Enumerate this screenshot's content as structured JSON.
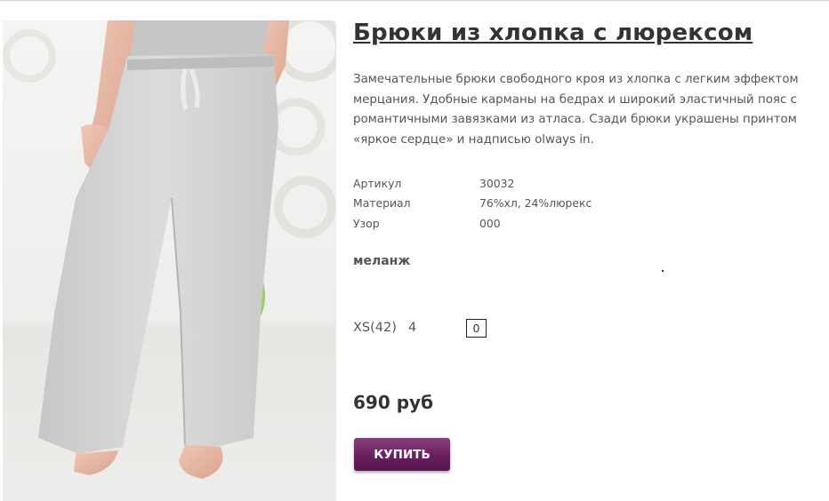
{
  "product": {
    "title": "Брюки из хлопка с люрексом",
    "description": "Замечательные брюки свободного кроя из хлопка с легким эффектом мерцания. Удобные карманы на бедрах и широкий эластичный пояс с романтичными завязками из атласа. Сзади брюки украшены принтом «яркое сердце» и надписью olways in.",
    "specs": [
      {
        "label": "Артикул",
        "value": "30032"
      },
      {
        "label": "Материал",
        "value": "76%хл, 24%люрекс"
      },
      {
        "label": "Узор",
        "value": "000"
      }
    ],
    "color_name": "меланж",
    "sizes": [
      {
        "size": "XS(42)",
        "stock": "4",
        "quantity": "0"
      }
    ],
    "price": "690 руб",
    "buy_label": "КУПИТЬ"
  },
  "colors": {
    "buy_button": "#6a1f5e",
    "title": "#333333",
    "text": "#555555"
  }
}
